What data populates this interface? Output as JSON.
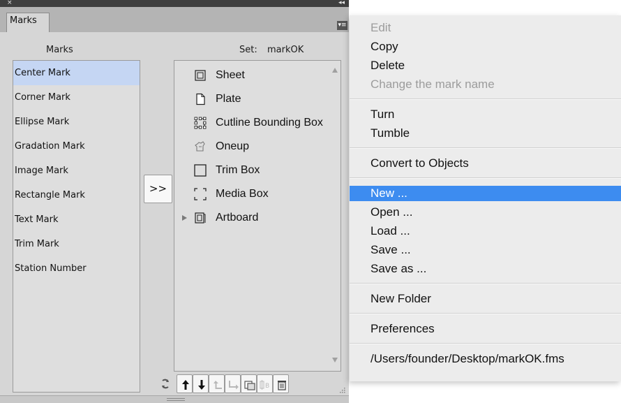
{
  "panel": {
    "close_glyph": "×",
    "collapse_glyph": "◂◂",
    "tab_label": "Marks",
    "menu_icon": "panel-menu-icon",
    "marks_header": "Marks",
    "set_header_label": "Set:",
    "set_name": "markOK",
    "move_button_label": ">>",
    "marks": [
      "Center Mark",
      "Corner Mark",
      "Ellipse Mark",
      "Gradation Mark",
      "Image Mark",
      "Rectangle Mark",
      "Text Mark",
      "Trim Mark",
      "Station Number"
    ],
    "selected_mark": "Center Mark",
    "set_items": [
      {
        "label": "Sheet",
        "icon": "sheet-icon"
      },
      {
        "label": "Plate",
        "icon": "plate-icon"
      },
      {
        "label": "Cutline Bounding Box",
        "icon": "cutline-bounding-box-icon"
      },
      {
        "label": "Oneup",
        "icon": "oneup-icon"
      },
      {
        "label": "Trim Box",
        "icon": "trim-box-icon"
      },
      {
        "label": "Media Box",
        "icon": "media-box-icon"
      },
      {
        "label": "Artboard",
        "icon": "artboard-icon",
        "expandable": true
      }
    ],
    "toolbar": [
      "refresh-icon",
      "move-up-icon",
      "move-down-icon",
      "outdent-icon",
      "indent-icon",
      "duplicate-icon",
      "rename-icon",
      "delete-icon"
    ]
  },
  "menu": {
    "groups": [
      [
        {
          "label": "Edit",
          "enabled": false
        },
        {
          "label": "Copy",
          "enabled": true
        },
        {
          "label": "Delete",
          "enabled": true
        },
        {
          "label": "Change the mark name",
          "enabled": false
        }
      ],
      [
        {
          "label": "Turn",
          "enabled": true
        },
        {
          "label": "Tumble",
          "enabled": true
        }
      ],
      [
        {
          "label": "Convert to Objects",
          "enabled": true
        }
      ],
      [
        {
          "label": "New ...",
          "enabled": true,
          "highlighted": true
        },
        {
          "label": "Open ...",
          "enabled": true
        },
        {
          "label": "Load ...",
          "enabled": true
        },
        {
          "label": "Save ...",
          "enabled": true
        },
        {
          "label": "Save as ...",
          "enabled": true
        }
      ],
      [
        {
          "label": "New Folder",
          "enabled": true
        }
      ],
      [
        {
          "label": "Preferences",
          "enabled": true
        }
      ],
      [
        {
          "label": "/Users/founder/Desktop/markOK.fms",
          "enabled": true
        }
      ]
    ],
    "highlight_color": "#3d8cf0",
    "disabled_color": "#9c9c9c"
  }
}
